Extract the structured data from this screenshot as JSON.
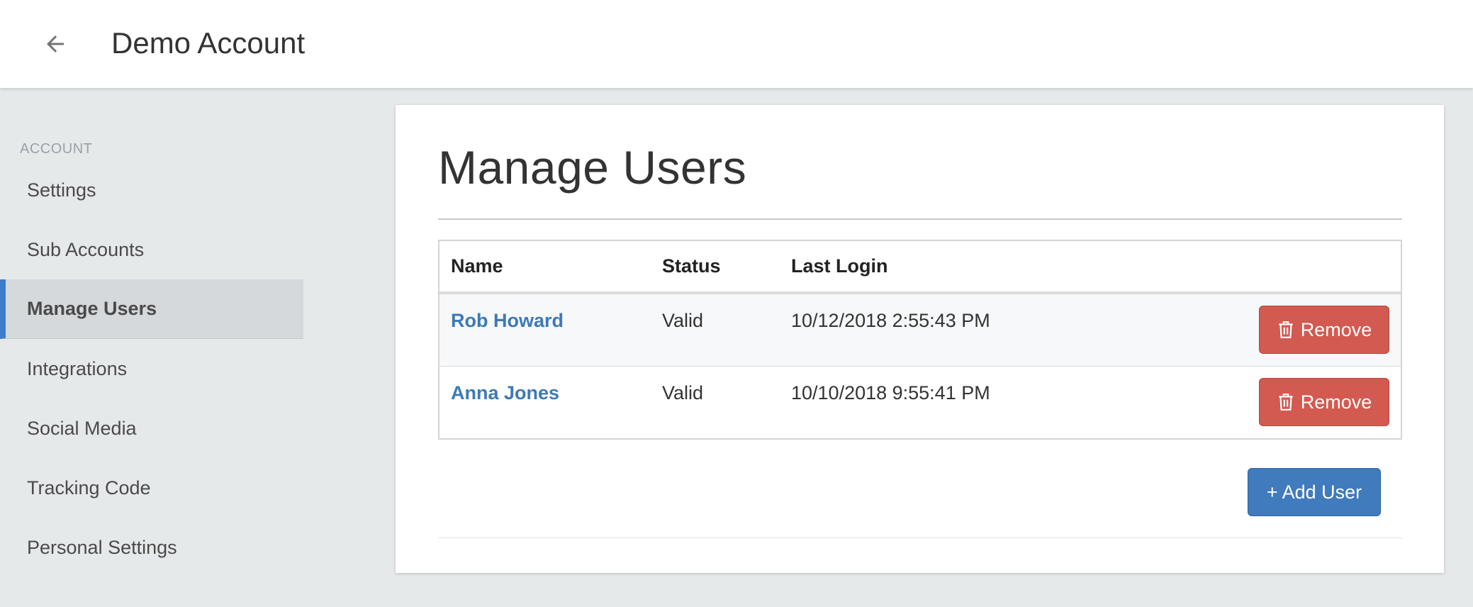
{
  "header": {
    "title": "Demo Account",
    "back_icon": "arrow-left-icon"
  },
  "sidebar": {
    "section_label": "ACCOUNT",
    "items": [
      {
        "label": "Settings",
        "active": false
      },
      {
        "label": "Sub Accounts",
        "active": false
      },
      {
        "label": "Manage Users",
        "active": true
      },
      {
        "label": "Integrations",
        "active": false
      },
      {
        "label": "Social Media",
        "active": false
      },
      {
        "label": "Tracking Code",
        "active": false
      },
      {
        "label": "Personal Settings",
        "active": false
      }
    ]
  },
  "main": {
    "title": "Manage Users",
    "table": {
      "columns": [
        "Name",
        "Status",
        "Last Login"
      ],
      "rows": [
        {
          "name": "Rob Howard",
          "status": "Valid",
          "last_login": "10/12/2018 2:55:43 PM",
          "action": "Remove"
        },
        {
          "name": "Anna Jones",
          "status": "Valid",
          "last_login": "10/10/2018 9:55:41 PM",
          "action": "Remove"
        }
      ]
    },
    "add_user_label": "+ Add User"
  },
  "colors": {
    "accent": "#3d7cc9",
    "danger": "#d35a51",
    "link": "#3d7ab5"
  }
}
